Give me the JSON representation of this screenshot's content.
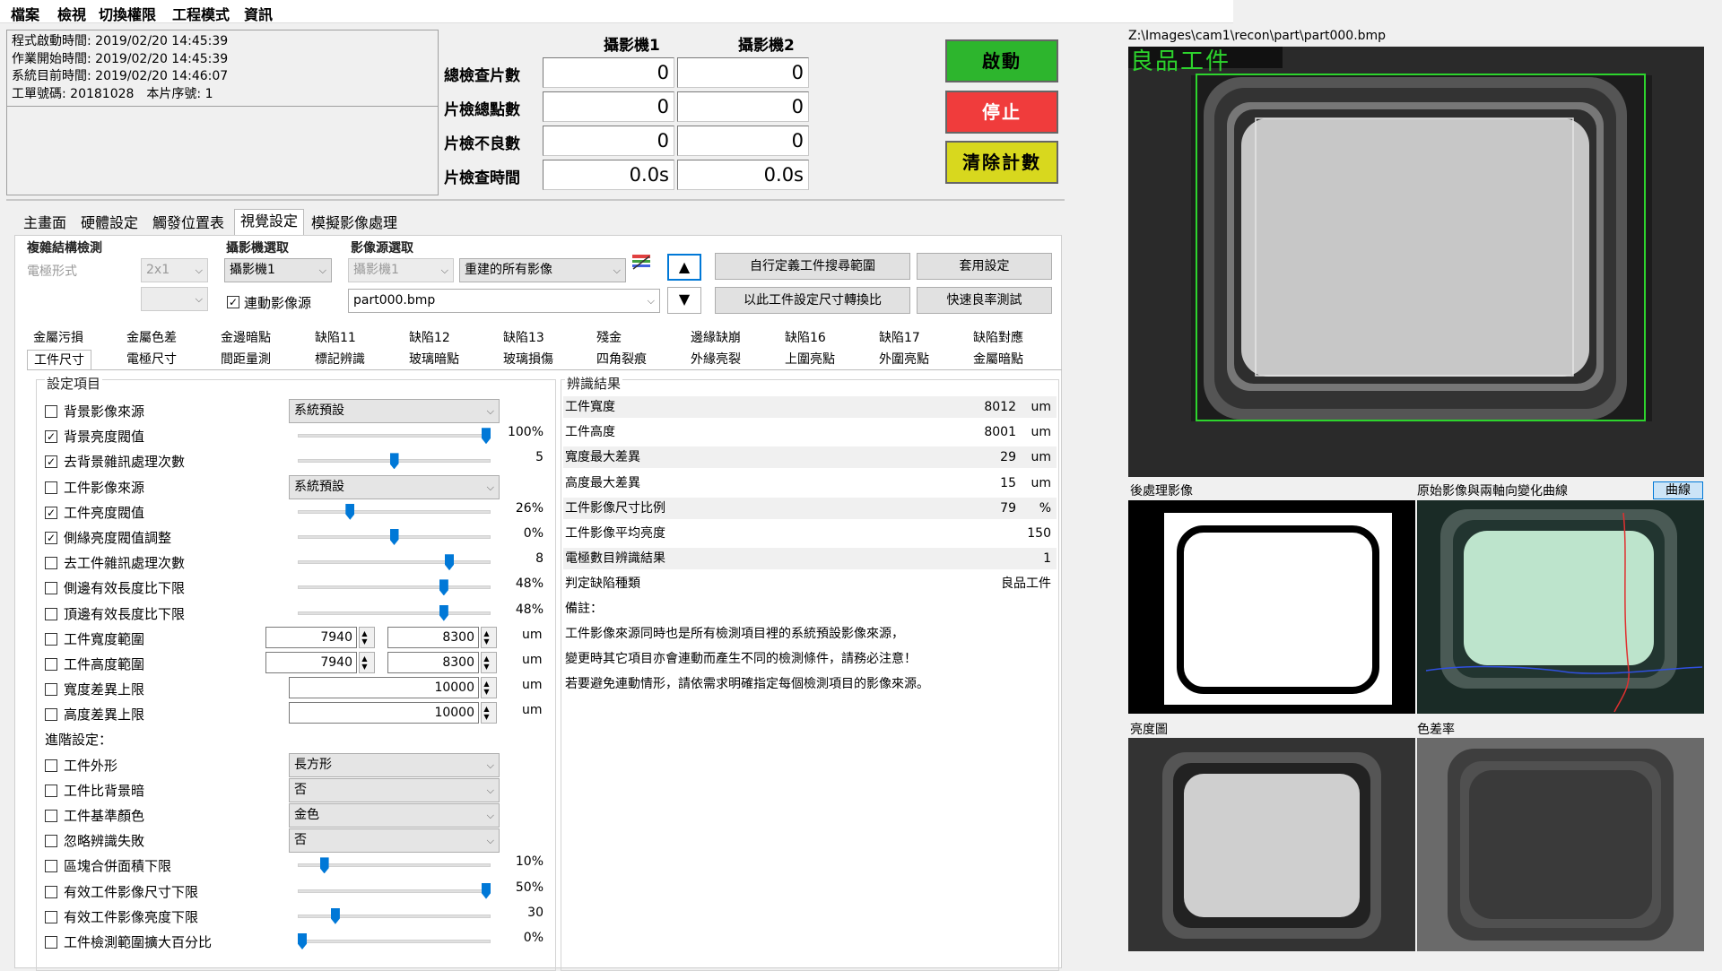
{
  "menu": [
    "檔案",
    "檢視",
    "切換權限",
    "工程模式",
    "資訊"
  ],
  "info": [
    "程式啟動時間: 2019/02/20 14:45:39",
    "作業開始時間: 2019/02/20 14:45:39",
    "系統目前時間: 2019/02/20 14:46:07",
    "工單號碼: 20181028　本片序號: 1"
  ],
  "stats": {
    "cam1": "攝影機1",
    "cam2": "攝影機2",
    "rows": [
      {
        "label": "總檢查片數",
        "v1": "0",
        "v2": "0"
      },
      {
        "label": "片檢總點數",
        "v1": "0",
        "v2": "0"
      },
      {
        "label": "片檢不良數",
        "v1": "0",
        "v2": "0"
      },
      {
        "label": "片檢查時間",
        "v1": "0.0s",
        "v2": "0.0s"
      }
    ]
  },
  "buttons": {
    "start": "啟動",
    "stop": "停止",
    "clear": "清除計數",
    "colors": {
      "start": "#2db52d",
      "stop": "#f03c3c",
      "clear": "#d8d81e"
    }
  },
  "tabs": [
    "主畫面",
    "硬體設定",
    "觸發位置表",
    "視覺設定",
    "模擬影像處理"
  ],
  "vision": {
    "grp_complex": "複雜結構檢測",
    "electrode_type": "電極形式",
    "electrode_val": "2x1",
    "grp_camera": "攝影機選取",
    "camera_val": "攝影機1",
    "link_label": "連動影像源",
    "grp_source": "影像源選取",
    "source_cam": "攝影機1",
    "source_mode": "重建的所有影像",
    "file": "part000.bmp",
    "btn_custom": "自行定義工件搜尋範圍",
    "btn_apply": "套用設定",
    "btn_convert": "以此工件設定尺寸轉換比",
    "btn_yield": "快速良率測試"
  },
  "subtabs_top": [
    "金屬污損",
    "金屬色差",
    "金邊暗點",
    "缺陷11",
    "缺陷12",
    "缺陷13",
    "殘金",
    "邊緣缺崩",
    "缺陷16",
    "缺陷17",
    "缺陷對應"
  ],
  "subtabs_bottom": [
    "工件尺寸",
    "電極尺寸",
    "間距量測",
    "標記辨識",
    "玻璃暗點",
    "玻璃損傷",
    "四角裂痕",
    "外緣亮裂",
    "上圍亮點",
    "外圍亮點",
    "金屬暗點"
  ],
  "settings": {
    "title": "設定項目",
    "items": [
      {
        "label": "背景影像來源",
        "checked": false,
        "kind": "combo",
        "value": "系統預設"
      },
      {
        "label": "背景亮度閥值",
        "checked": true,
        "kind": "slider",
        "value": "100%",
        "pos": 1.0
      },
      {
        "label": "去背景雜訊處理次數",
        "checked": true,
        "kind": "slider",
        "value": "5",
        "pos": 0.5
      },
      {
        "label": "工件影像來源",
        "checked": false,
        "kind": "combo",
        "value": "系統預設"
      },
      {
        "label": "工件亮度閥值",
        "checked": true,
        "kind": "slider",
        "value": "26%",
        "pos": 0.26
      },
      {
        "label": "側緣亮度閥值調整",
        "checked": true,
        "kind": "slider",
        "value": "0%",
        "pos": 0.5
      },
      {
        "label": "去工件雜訊處理次數",
        "checked": false,
        "kind": "slider",
        "value": "8",
        "pos": 0.8
      },
      {
        "label": "側邊有效長度比下限",
        "checked": false,
        "kind": "slider",
        "value": "48%",
        "pos": 0.77
      },
      {
        "label": "頂邊有效長度比下限",
        "checked": false,
        "kind": "slider",
        "value": "48%",
        "pos": 0.77
      },
      {
        "label": "工件寬度範圍",
        "checked": false,
        "kind": "range",
        "v1": "7940",
        "v2": "8300",
        "unit": "um"
      },
      {
        "label": "工件高度範圍",
        "checked": false,
        "kind": "range",
        "v1": "7940",
        "v2": "8300",
        "unit": "um"
      },
      {
        "label": "寬度差異上限",
        "checked": false,
        "kind": "num",
        "value": "10000",
        "unit": "um"
      },
      {
        "label": "高度差異上限",
        "checked": false,
        "kind": "num",
        "value": "10000",
        "unit": "um"
      }
    ],
    "adv_title": "進階設定：",
    "adv": [
      {
        "label": "工件外形",
        "checked": false,
        "kind": "combo",
        "value": "長方形"
      },
      {
        "label": "工件比背景暗",
        "checked": false,
        "kind": "combo",
        "value": "否"
      },
      {
        "label": "工件基準顏色",
        "checked": false,
        "kind": "combo",
        "value": "金色"
      },
      {
        "label": "忽略辨識失敗",
        "checked": false,
        "kind": "combo",
        "value": "否"
      },
      {
        "label": "區塊合併面積下限",
        "checked": false,
        "kind": "slider",
        "value": "10%",
        "pos": 0.12
      },
      {
        "label": "有效工件影像尺寸下限",
        "checked": false,
        "kind": "slider",
        "value": "50%",
        "pos": 1.0
      },
      {
        "label": "有效工件影像亮度下限",
        "checked": false,
        "kind": "slider",
        "value": "30",
        "pos": 0.18
      },
      {
        "label": "工件檢測範圍擴大百分比",
        "checked": false,
        "kind": "slider",
        "value": "0%",
        "pos": 0.0
      }
    ]
  },
  "results": {
    "title": "辨識結果",
    "rows": [
      {
        "label": "工件寬度",
        "value": "8012",
        "unit": "um"
      },
      {
        "label": "工件高度",
        "value": "8001",
        "unit": "um"
      },
      {
        "label": "寬度最大差異",
        "value": "29",
        "unit": "um"
      },
      {
        "label": "高度最大差異",
        "value": "15",
        "unit": "um"
      },
      {
        "label": "工件影像尺寸比例",
        "value": "79",
        "unit": "%"
      },
      {
        "label": "工件影像平均亮度",
        "value": "150",
        "unit": ""
      },
      {
        "label": "電極數目辨識結果",
        "value": "1",
        "unit": ""
      },
      {
        "label": "判定缺陷種類",
        "value": "良品工件",
        "unit": ""
      }
    ],
    "note_title": "備註：",
    "notes": [
      "工件影像來源同時也是所有檢測項目裡的系統預設影像來源，",
      "變更時其它項目亦會連動而產生不同的檢測條件，請務必注意！",
      "若要避免連動情形，請依需求明確指定每個檢測項目的影像來源。"
    ]
  },
  "images": {
    "path": "Z:\\Images\\cam1\\recon\\part\\part000.bmp",
    "overlay": "良品工件",
    "processed": "後處理影像",
    "curve_title": "原始影像與兩軸向變化曲線",
    "curve_btn": "曲線",
    "brightness": "亮度圖",
    "color_diff": "色差率"
  }
}
